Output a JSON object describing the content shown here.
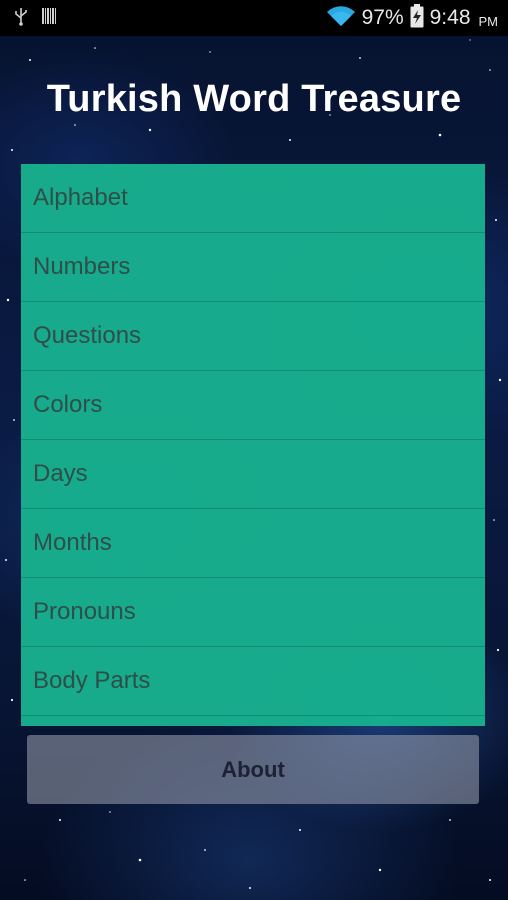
{
  "status_bar": {
    "battery_percent": "97%",
    "time": "9:48",
    "am_pm": "PM",
    "icons": [
      "usb-icon",
      "barcode-icon",
      "wifi-icon",
      "battery-charging-icon"
    ]
  },
  "app": {
    "title": "Turkish Word Treasure"
  },
  "menu": {
    "items": [
      {
        "label": "Alphabet"
      },
      {
        "label": "Numbers"
      },
      {
        "label": "Questions"
      },
      {
        "label": "Colors"
      },
      {
        "label": "Days"
      },
      {
        "label": "Months"
      },
      {
        "label": "Pronouns"
      },
      {
        "label": "Body Parts"
      }
    ]
  },
  "about_button": {
    "label": "About"
  },
  "colors": {
    "list_background": "#18b08e",
    "list_text": "#2e4f49",
    "title_text": "#ffffff",
    "status_bar": "#000000"
  }
}
